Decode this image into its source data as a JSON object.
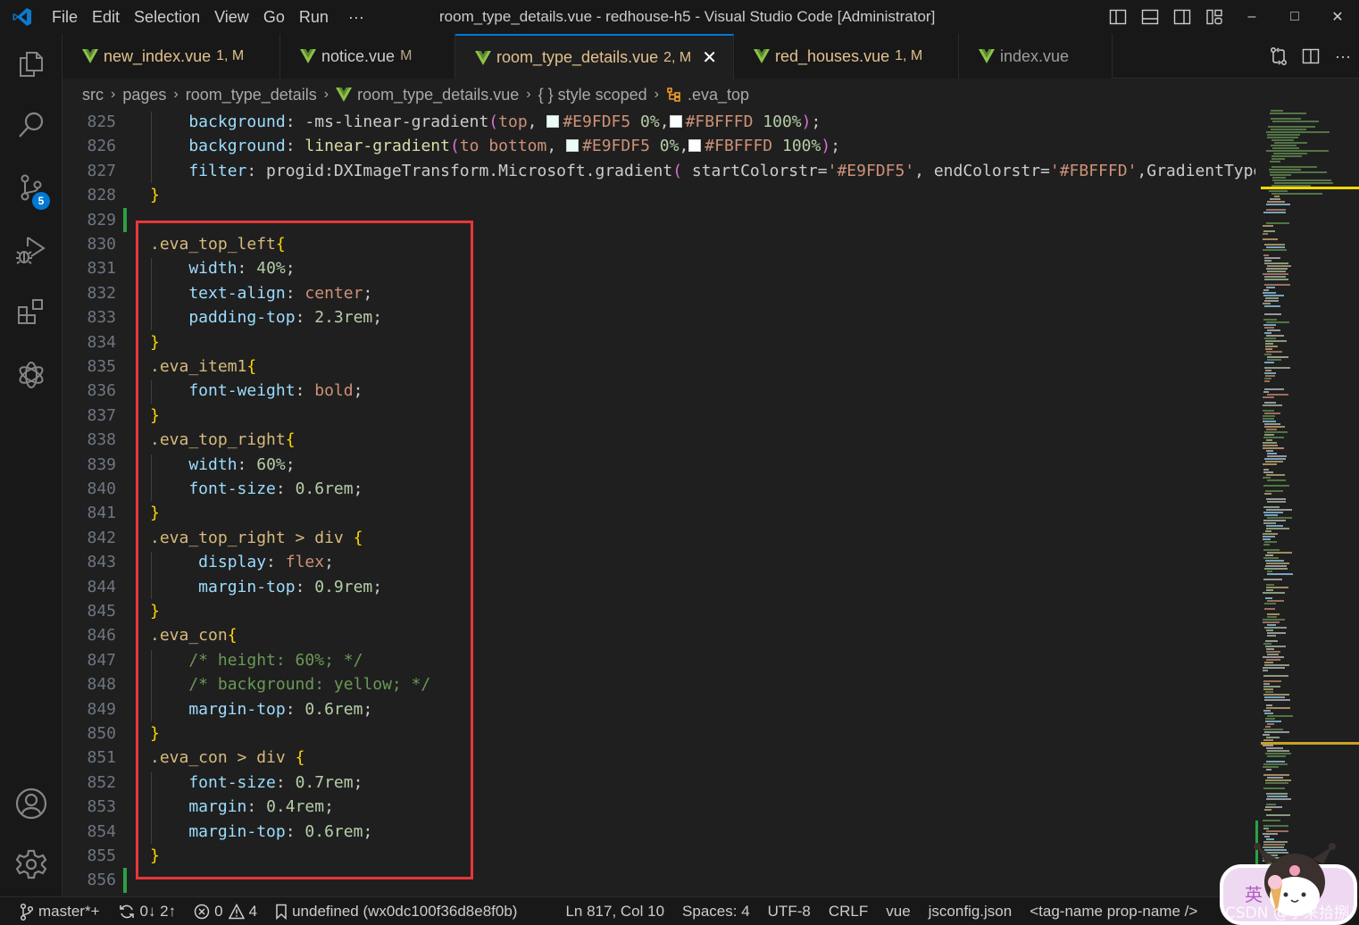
{
  "titlebar": {
    "menus": [
      "File",
      "Edit",
      "Selection",
      "View",
      "Go",
      "Run",
      "···"
    ],
    "menu_mnemonics": [
      "F",
      "E",
      "S",
      "V",
      "G",
      "R",
      ""
    ],
    "window_title": "room_type_details.vue - redhouse-h5 - Visual Studio Code [Administrator]",
    "window_controls": {
      "minimize": "–",
      "maximize": "□",
      "close": "✕"
    }
  },
  "activity_bar": {
    "items": [
      "explorer-icon",
      "search-icon",
      "source-control-icon",
      "run-debug-icon",
      "extensions-icon",
      "chatgpt-icon"
    ],
    "source_control_badge": "5",
    "bottom_items": [
      "account-icon",
      "settings-gear-icon"
    ]
  },
  "tabs": [
    {
      "name": "new_index.vue",
      "status": "1, M",
      "active": false
    },
    {
      "name": "notice.vue",
      "status": "M",
      "active": false
    },
    {
      "name": "room_type_details.vue",
      "status": "2, M",
      "active": true,
      "close": "✕"
    },
    {
      "name": "red_houses.vue",
      "status": "1, M",
      "active": false
    },
    {
      "name": "index.vue",
      "status": "",
      "active": false
    }
  ],
  "breadcrumb": {
    "items": [
      "src",
      "pages",
      "room_type_details",
      "room_type_details.vue",
      "{ } style scoped",
      ".eva_top"
    ],
    "separator": "›"
  },
  "editor": {
    "lines": [
      {
        "n": "825",
        "tokens": [
          [
            "p",
            "    background"
          ],
          [
            "o",
            ": -ms-linear-gradient"
          ],
          [
            "b2",
            "("
          ],
          [
            "s",
            "top"
          ],
          [
            "o",
            ", "
          ],
          [
            "sw",
            "#E9FDF5"
          ],
          [
            "s",
            "#E9FDF5"
          ],
          [
            "o",
            " "
          ],
          [
            "n",
            "0%"
          ],
          [
            "o",
            ","
          ],
          [
            "sw",
            "#FBFFFD"
          ],
          [
            "s",
            "#FBFFFD"
          ],
          [
            "o",
            " "
          ],
          [
            "n",
            "100%"
          ],
          [
            "b2",
            ")"
          ],
          [
            "o",
            ";"
          ]
        ]
      },
      {
        "n": "826",
        "tokens": [
          [
            "p",
            "    background"
          ],
          [
            "o",
            ": "
          ],
          [
            "f",
            "linear-gradient"
          ],
          [
            "b2",
            "("
          ],
          [
            "s",
            "to bottom"
          ],
          [
            "o",
            ", "
          ],
          [
            "sw",
            "#E9FDF5"
          ],
          [
            "s",
            "#E9FDF5"
          ],
          [
            "o",
            " "
          ],
          [
            "n",
            "0%"
          ],
          [
            "o",
            ","
          ],
          [
            "sw",
            "#FBFFFD"
          ],
          [
            "s",
            "#FBFFFD"
          ],
          [
            "o",
            " "
          ],
          [
            "n",
            "100%"
          ],
          [
            "b2",
            ")"
          ],
          [
            "o",
            ";"
          ]
        ]
      },
      {
        "n": "827",
        "tokens": [
          [
            "p",
            "    filter"
          ],
          [
            "o",
            ": progid:DXImageTransform.Microsoft.gradient"
          ],
          [
            "b2",
            "("
          ],
          [
            "o",
            " startColorstr="
          ],
          [
            "s",
            "'#E9FDF5'"
          ],
          [
            "o",
            ", endColorstr="
          ],
          [
            "s",
            "'#FBFFFD'"
          ],
          [
            "o",
            ",GradientType"
          ]
        ]
      },
      {
        "n": "828",
        "tokens": [
          [
            "b",
            "}"
          ]
        ]
      },
      {
        "n": "829",
        "tokens": []
      },
      {
        "n": "830",
        "tokens": [
          [
            "sel",
            ".eva_top_left"
          ],
          [
            "b",
            "{"
          ]
        ]
      },
      {
        "n": "831",
        "tokens": [
          [
            "p",
            "    width"
          ],
          [
            "o",
            ": "
          ],
          [
            "n",
            "40%"
          ],
          [
            "o",
            ";"
          ]
        ]
      },
      {
        "n": "832",
        "tokens": [
          [
            "p",
            "    text-align"
          ],
          [
            "o",
            ": "
          ],
          [
            "s",
            "center"
          ],
          [
            "o",
            ";"
          ]
        ]
      },
      {
        "n": "833",
        "tokens": [
          [
            "p",
            "    padding-top"
          ],
          [
            "o",
            ": "
          ],
          [
            "n",
            "2.3rem"
          ],
          [
            "o",
            ";"
          ]
        ]
      },
      {
        "n": "834",
        "tokens": [
          [
            "b",
            "}"
          ]
        ]
      },
      {
        "n": "835",
        "tokens": [
          [
            "sel",
            ".eva_item1"
          ],
          [
            "b",
            "{"
          ]
        ]
      },
      {
        "n": "836",
        "tokens": [
          [
            "p",
            "    font-weight"
          ],
          [
            "o",
            ": "
          ],
          [
            "s",
            "bold"
          ],
          [
            "o",
            ";"
          ]
        ]
      },
      {
        "n": "837",
        "tokens": [
          [
            "b",
            "}"
          ]
        ]
      },
      {
        "n": "838",
        "tokens": [
          [
            "sel",
            ".eva_top_right"
          ],
          [
            "b",
            "{"
          ]
        ]
      },
      {
        "n": "839",
        "tokens": [
          [
            "p",
            "    width"
          ],
          [
            "o",
            ": "
          ],
          [
            "n",
            "60%"
          ],
          [
            "o",
            ";"
          ]
        ]
      },
      {
        "n": "840",
        "tokens": [
          [
            "p",
            "    font-size"
          ],
          [
            "o",
            ": "
          ],
          [
            "n",
            "0.6rem"
          ],
          [
            "o",
            ";"
          ]
        ]
      },
      {
        "n": "841",
        "tokens": [
          [
            "b",
            "}"
          ]
        ]
      },
      {
        "n": "842",
        "tokens": [
          [
            "sel",
            ".eva_top_right > div "
          ],
          [
            "b",
            "{"
          ]
        ]
      },
      {
        "n": "843",
        "tokens": [
          [
            "p",
            "     display"
          ],
          [
            "o",
            ": "
          ],
          [
            "s",
            "flex"
          ],
          [
            "o",
            ";"
          ]
        ]
      },
      {
        "n": "844",
        "tokens": [
          [
            "p",
            "     margin-top"
          ],
          [
            "o",
            ": "
          ],
          [
            "n",
            "0.9rem"
          ],
          [
            "o",
            ";"
          ]
        ]
      },
      {
        "n": "845",
        "tokens": [
          [
            "b",
            "}"
          ]
        ]
      },
      {
        "n": "846",
        "tokens": [
          [
            "sel",
            ".eva_con"
          ],
          [
            "b",
            "{"
          ]
        ]
      },
      {
        "n": "847",
        "tokens": [
          [
            "c",
            "    /* height: 60%; */"
          ]
        ]
      },
      {
        "n": "848",
        "tokens": [
          [
            "c",
            "    /* background: yellow; */"
          ]
        ]
      },
      {
        "n": "849",
        "tokens": [
          [
            "p",
            "    margin-top"
          ],
          [
            "o",
            ": "
          ],
          [
            "n",
            "0.6rem"
          ],
          [
            "o",
            ";"
          ]
        ]
      },
      {
        "n": "850",
        "tokens": [
          [
            "b",
            "}"
          ]
        ]
      },
      {
        "n": "851",
        "tokens": [
          [
            "sel",
            ".eva_con > div "
          ],
          [
            "b",
            "{"
          ]
        ]
      },
      {
        "n": "852",
        "tokens": [
          [
            "p",
            "    font-size"
          ],
          [
            "o",
            ": "
          ],
          [
            "n",
            "0.7rem"
          ],
          [
            "o",
            ";"
          ]
        ]
      },
      {
        "n": "853",
        "tokens": [
          [
            "p",
            "    margin"
          ],
          [
            "o",
            ": "
          ],
          [
            "n",
            "0.4rem"
          ],
          [
            "o",
            ";"
          ]
        ]
      },
      {
        "n": "854",
        "tokens": [
          [
            "p",
            "    margin-top"
          ],
          [
            "o",
            ": "
          ],
          [
            "n",
            "0.6rem"
          ],
          [
            "o",
            ";"
          ]
        ]
      },
      {
        "n": "855",
        "tokens": [
          [
            "b",
            "}"
          ]
        ]
      },
      {
        "n": "856",
        "tokens": []
      }
    ]
  },
  "statusbar": {
    "branch": "master*+",
    "sync": "0↓ 2↑",
    "errors": "0",
    "warnings": "4",
    "bookmark": "undefined (wx0dc100f36d8e8f0b)",
    "cursor": "Ln 817, Col 10",
    "spaces": "Spaces: 4",
    "encoding": "UTF-8",
    "eol": "CRLF",
    "language": "vue",
    "config": "jsconfig.json",
    "snippet": "<tag-name prop-name />"
  },
  "watermark": {
    "text": "CSDN @小来拾捌",
    "ime": "英"
  },
  "colors": {
    "accent": "#0078d4",
    "highlight_box": "#e8363b",
    "git_added": "#2ea043",
    "modified_text": "#e2c08d"
  }
}
